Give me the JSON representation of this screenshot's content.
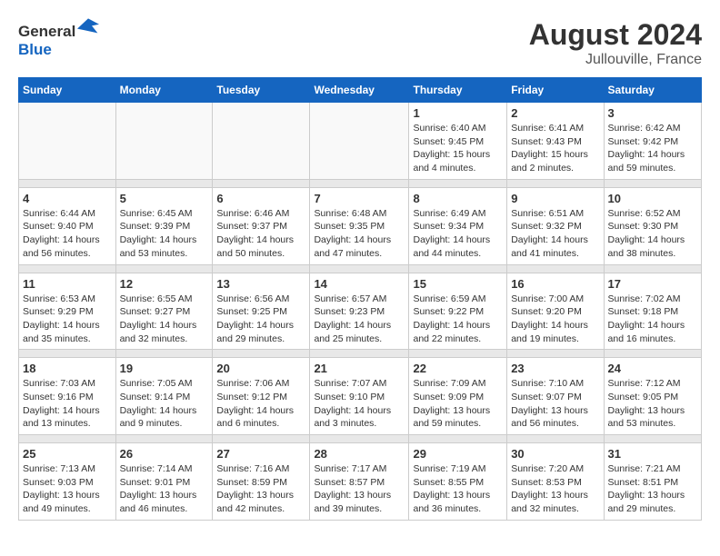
{
  "header": {
    "logo_general": "General",
    "logo_blue": "Blue",
    "title": "August 2024",
    "subtitle": "Jullouville, France"
  },
  "weekdays": [
    "Sunday",
    "Monday",
    "Tuesday",
    "Wednesday",
    "Thursday",
    "Friday",
    "Saturday"
  ],
  "weeks": [
    [
      {
        "day": "",
        "sunrise": "",
        "sunset": "",
        "daylight": ""
      },
      {
        "day": "",
        "sunrise": "",
        "sunset": "",
        "daylight": ""
      },
      {
        "day": "",
        "sunrise": "",
        "sunset": "",
        "daylight": ""
      },
      {
        "day": "",
        "sunrise": "",
        "sunset": "",
        "daylight": ""
      },
      {
        "day": "1",
        "sunrise": "Sunrise: 6:40 AM",
        "sunset": "Sunset: 9:45 PM",
        "daylight": "Daylight: 15 hours and 4 minutes."
      },
      {
        "day": "2",
        "sunrise": "Sunrise: 6:41 AM",
        "sunset": "Sunset: 9:43 PM",
        "daylight": "Daylight: 15 hours and 2 minutes."
      },
      {
        "day": "3",
        "sunrise": "Sunrise: 6:42 AM",
        "sunset": "Sunset: 9:42 PM",
        "daylight": "Daylight: 14 hours and 59 minutes."
      }
    ],
    [
      {
        "day": "4",
        "sunrise": "Sunrise: 6:44 AM",
        "sunset": "Sunset: 9:40 PM",
        "daylight": "Daylight: 14 hours and 56 minutes."
      },
      {
        "day": "5",
        "sunrise": "Sunrise: 6:45 AM",
        "sunset": "Sunset: 9:39 PM",
        "daylight": "Daylight: 14 hours and 53 minutes."
      },
      {
        "day": "6",
        "sunrise": "Sunrise: 6:46 AM",
        "sunset": "Sunset: 9:37 PM",
        "daylight": "Daylight: 14 hours and 50 minutes."
      },
      {
        "day": "7",
        "sunrise": "Sunrise: 6:48 AM",
        "sunset": "Sunset: 9:35 PM",
        "daylight": "Daylight: 14 hours and 47 minutes."
      },
      {
        "day": "8",
        "sunrise": "Sunrise: 6:49 AM",
        "sunset": "Sunset: 9:34 PM",
        "daylight": "Daylight: 14 hours and 44 minutes."
      },
      {
        "day": "9",
        "sunrise": "Sunrise: 6:51 AM",
        "sunset": "Sunset: 9:32 PM",
        "daylight": "Daylight: 14 hours and 41 minutes."
      },
      {
        "day": "10",
        "sunrise": "Sunrise: 6:52 AM",
        "sunset": "Sunset: 9:30 PM",
        "daylight": "Daylight: 14 hours and 38 minutes."
      }
    ],
    [
      {
        "day": "11",
        "sunrise": "Sunrise: 6:53 AM",
        "sunset": "Sunset: 9:29 PM",
        "daylight": "Daylight: 14 hours and 35 minutes."
      },
      {
        "day": "12",
        "sunrise": "Sunrise: 6:55 AM",
        "sunset": "Sunset: 9:27 PM",
        "daylight": "Daylight: 14 hours and 32 minutes."
      },
      {
        "day": "13",
        "sunrise": "Sunrise: 6:56 AM",
        "sunset": "Sunset: 9:25 PM",
        "daylight": "Daylight: 14 hours and 29 minutes."
      },
      {
        "day": "14",
        "sunrise": "Sunrise: 6:57 AM",
        "sunset": "Sunset: 9:23 PM",
        "daylight": "Daylight: 14 hours and 25 minutes."
      },
      {
        "day": "15",
        "sunrise": "Sunrise: 6:59 AM",
        "sunset": "Sunset: 9:22 PM",
        "daylight": "Daylight: 14 hours and 22 minutes."
      },
      {
        "day": "16",
        "sunrise": "Sunrise: 7:00 AM",
        "sunset": "Sunset: 9:20 PM",
        "daylight": "Daylight: 14 hours and 19 minutes."
      },
      {
        "day": "17",
        "sunrise": "Sunrise: 7:02 AM",
        "sunset": "Sunset: 9:18 PM",
        "daylight": "Daylight: 14 hours and 16 minutes."
      }
    ],
    [
      {
        "day": "18",
        "sunrise": "Sunrise: 7:03 AM",
        "sunset": "Sunset: 9:16 PM",
        "daylight": "Daylight: 14 hours and 13 minutes."
      },
      {
        "day": "19",
        "sunrise": "Sunrise: 7:05 AM",
        "sunset": "Sunset: 9:14 PM",
        "daylight": "Daylight: 14 hours and 9 minutes."
      },
      {
        "day": "20",
        "sunrise": "Sunrise: 7:06 AM",
        "sunset": "Sunset: 9:12 PM",
        "daylight": "Daylight: 14 hours and 6 minutes."
      },
      {
        "day": "21",
        "sunrise": "Sunrise: 7:07 AM",
        "sunset": "Sunset: 9:10 PM",
        "daylight": "Daylight: 14 hours and 3 minutes."
      },
      {
        "day": "22",
        "sunrise": "Sunrise: 7:09 AM",
        "sunset": "Sunset: 9:09 PM",
        "daylight": "Daylight: 13 hours and 59 minutes."
      },
      {
        "day": "23",
        "sunrise": "Sunrise: 7:10 AM",
        "sunset": "Sunset: 9:07 PM",
        "daylight": "Daylight: 13 hours and 56 minutes."
      },
      {
        "day": "24",
        "sunrise": "Sunrise: 7:12 AM",
        "sunset": "Sunset: 9:05 PM",
        "daylight": "Daylight: 13 hours and 53 minutes."
      }
    ],
    [
      {
        "day": "25",
        "sunrise": "Sunrise: 7:13 AM",
        "sunset": "Sunset: 9:03 PM",
        "daylight": "Daylight: 13 hours and 49 minutes."
      },
      {
        "day": "26",
        "sunrise": "Sunrise: 7:14 AM",
        "sunset": "Sunset: 9:01 PM",
        "daylight": "Daylight: 13 hours and 46 minutes."
      },
      {
        "day": "27",
        "sunrise": "Sunrise: 7:16 AM",
        "sunset": "Sunset: 8:59 PM",
        "daylight": "Daylight: 13 hours and 42 minutes."
      },
      {
        "day": "28",
        "sunrise": "Sunrise: 7:17 AM",
        "sunset": "Sunset: 8:57 PM",
        "daylight": "Daylight: 13 hours and 39 minutes."
      },
      {
        "day": "29",
        "sunrise": "Sunrise: 7:19 AM",
        "sunset": "Sunset: 8:55 PM",
        "daylight": "Daylight: 13 hours and 36 minutes."
      },
      {
        "day": "30",
        "sunrise": "Sunrise: 7:20 AM",
        "sunset": "Sunset: 8:53 PM",
        "daylight": "Daylight: 13 hours and 32 minutes."
      },
      {
        "day": "31",
        "sunrise": "Sunrise: 7:21 AM",
        "sunset": "Sunset: 8:51 PM",
        "daylight": "Daylight: 13 hours and 29 minutes."
      }
    ]
  ]
}
